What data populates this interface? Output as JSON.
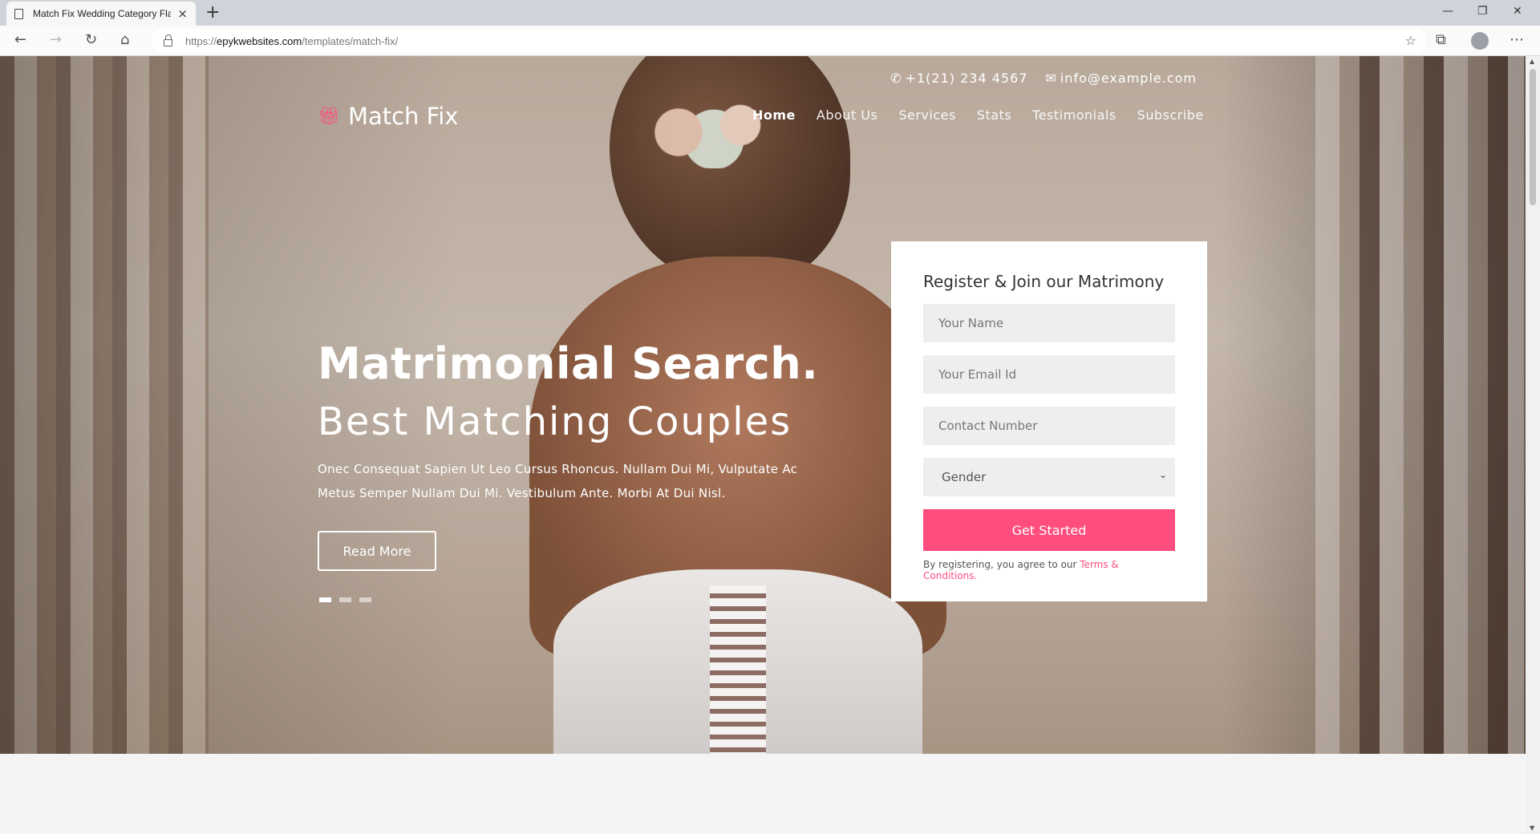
{
  "browser": {
    "tab_title": "Match Fix Wedding Category Fla",
    "tab_close": "×",
    "new_tab": "+",
    "url_scheme": "https://",
    "url_host": "epykwebsites.com",
    "url_path": "/templates/match-fix/",
    "window_controls": [
      "—",
      "❐",
      "✕"
    ]
  },
  "topbar": {
    "phone": "+1(21) 234 4567",
    "email": "info@example.com"
  },
  "brand": {
    "name": "Match Fix"
  },
  "nav": [
    "Home",
    "About Us",
    "Services",
    "Stats",
    "Testimonials",
    "Subscribe"
  ],
  "hero": {
    "headline": "Matrimonial Search.",
    "subline": "Best Matching Couples",
    "description": "Onec Consequat Sapien Ut Leo Cursus Rhoncus. Nullam Dui Mi, Vulputate Ac Metus Semper Nullam Dui Mi. Vestibulum Ante. Morbi At Dui Nisl.",
    "cta": "Read More",
    "slide_count": 3,
    "active_slide": 1
  },
  "form": {
    "title": "Register & Join our Matrimony",
    "name_placeholder": "Your Name",
    "email_placeholder": "Your Email Id",
    "phone_placeholder": "Contact Number",
    "gender_selected": "Gender",
    "submit": "Get Started",
    "terms_prefix": "By registering, you agree to our ",
    "terms_link": "Terms & Conditions."
  },
  "colors": {
    "accent": "#ff4e7e",
    "panel": "#ffffff",
    "field": "#eeeeee"
  }
}
